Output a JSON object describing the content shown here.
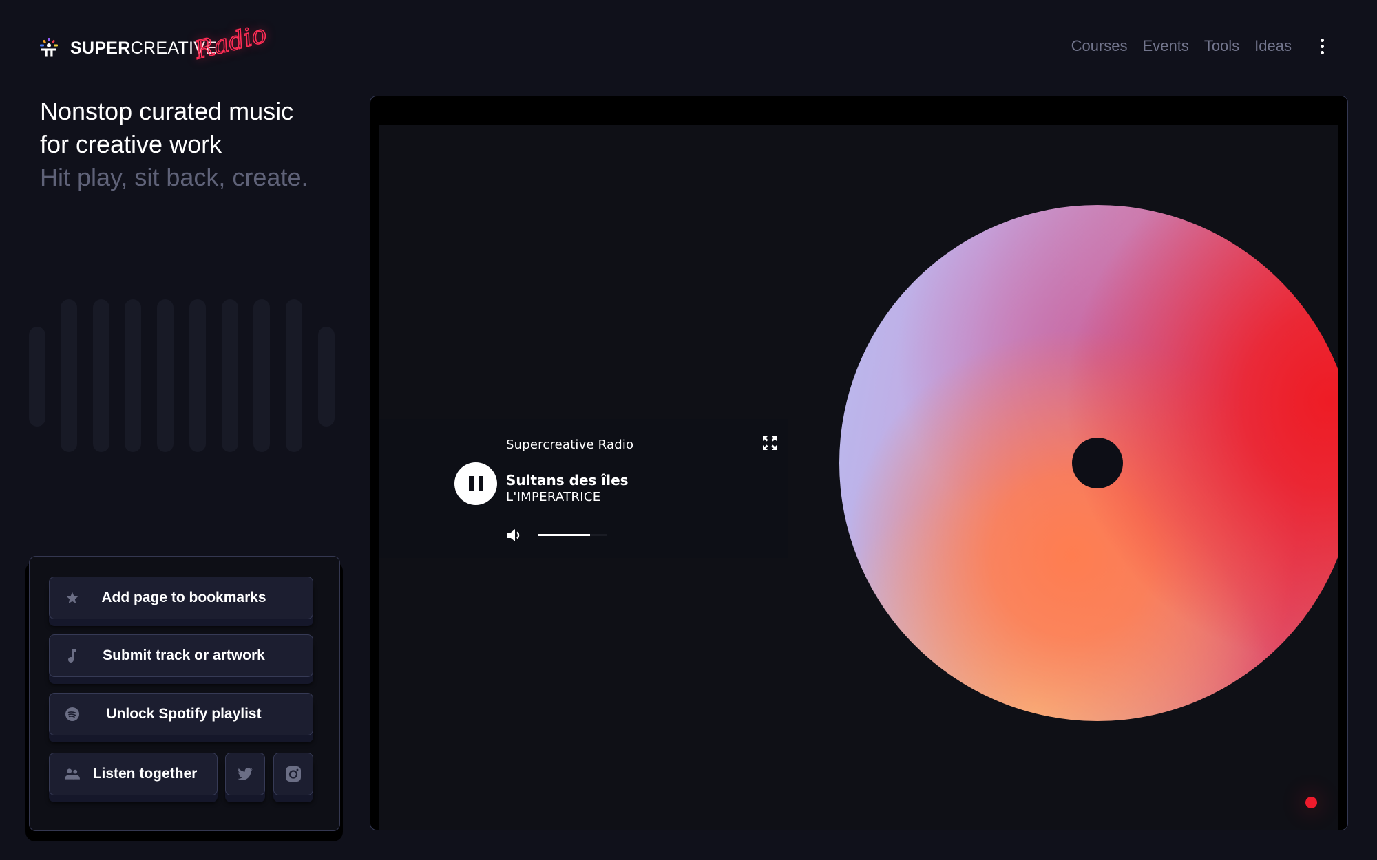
{
  "brand": {
    "name_bold": "SUPER",
    "name_regular": "CREATIVE",
    "script": "Radio",
    "ray_colors": [
      "#8e5cf7",
      "#ef3b4f",
      "#f5a524",
      "#4d7cf5",
      "#f2d23c"
    ]
  },
  "nav": {
    "items": [
      {
        "label": "Courses"
      },
      {
        "label": "Events"
      },
      {
        "label": "Tools"
      },
      {
        "label": "Ideas"
      }
    ],
    "more_icon": "vertical-ellipsis"
  },
  "hero": {
    "line1": "Nonstop curated music",
    "line2": "for creative work",
    "line3": "Hit play, sit back, create."
  },
  "actions": {
    "bookmark": {
      "label": "Add page to bookmarks",
      "icon": "star"
    },
    "submit": {
      "label": "Submit track or artwork",
      "icon": "music-note"
    },
    "spotify": {
      "label": "Unlock Spotify playlist",
      "icon": "spotify"
    },
    "listen": {
      "label": "Listen together",
      "icon": "users"
    },
    "twitter": {
      "icon": "twitter"
    },
    "instagram": {
      "icon": "instagram"
    }
  },
  "player": {
    "station": "Supercreative Radio",
    "track": "Sultans des îles",
    "artist": "L'IMPERATRICE",
    "state": "playing",
    "volume": 0.75,
    "live_indicator_color": "#ee1b2c"
  },
  "colors": {
    "background": "#10111b",
    "button_bg": "#1c1e30",
    "muted_text": "#5f6278",
    "accent_neon": "#ff2d55"
  }
}
